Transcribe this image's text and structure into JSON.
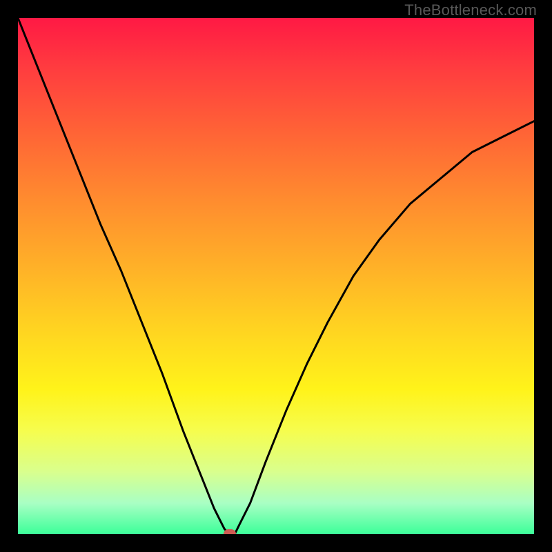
{
  "watermark": {
    "text": "TheBottleneck.com"
  },
  "chart_data": {
    "type": "line",
    "title": "",
    "xlabel": "",
    "ylabel": "",
    "xlim": [
      0,
      100
    ],
    "ylim": [
      0,
      100
    ],
    "grid": false,
    "background_gradient": {
      "orientation": "vertical",
      "stops": [
        {
          "pos": 0.0,
          "color": "#ff1944"
        },
        {
          "pos": 0.1,
          "color": "#ff3d3f"
        },
        {
          "pos": 0.22,
          "color": "#ff6336"
        },
        {
          "pos": 0.35,
          "color": "#ff8b2f"
        },
        {
          "pos": 0.48,
          "color": "#ffb028"
        },
        {
          "pos": 0.6,
          "color": "#ffd321"
        },
        {
          "pos": 0.72,
          "color": "#fff31a"
        },
        {
          "pos": 0.8,
          "color": "#f6fd4e"
        },
        {
          "pos": 0.88,
          "color": "#d9ff8e"
        },
        {
          "pos": 0.94,
          "color": "#a9ffc4"
        },
        {
          "pos": 1.0,
          "color": "#3cff99"
        }
      ]
    },
    "series": [
      {
        "name": "bottleneck-curve",
        "color": "#000000",
        "x": [
          0,
          4,
          8,
          12,
          16,
          20,
          24,
          28,
          32,
          34,
          36,
          38,
          39,
          40,
          41,
          42,
          43,
          45,
          48,
          52,
          56,
          60,
          65,
          70,
          76,
          82,
          88,
          94,
          100
        ],
        "y": [
          100,
          90,
          80,
          70,
          60,
          51,
          41,
          31,
          20,
          15,
          10,
          5,
          3,
          1,
          0,
          0,
          2,
          6,
          14,
          24,
          33,
          41,
          50,
          57,
          64,
          69,
          74,
          77,
          80
        ]
      }
    ],
    "marker": {
      "x": 41,
      "y": 0,
      "color": "#cd5b52"
    }
  }
}
